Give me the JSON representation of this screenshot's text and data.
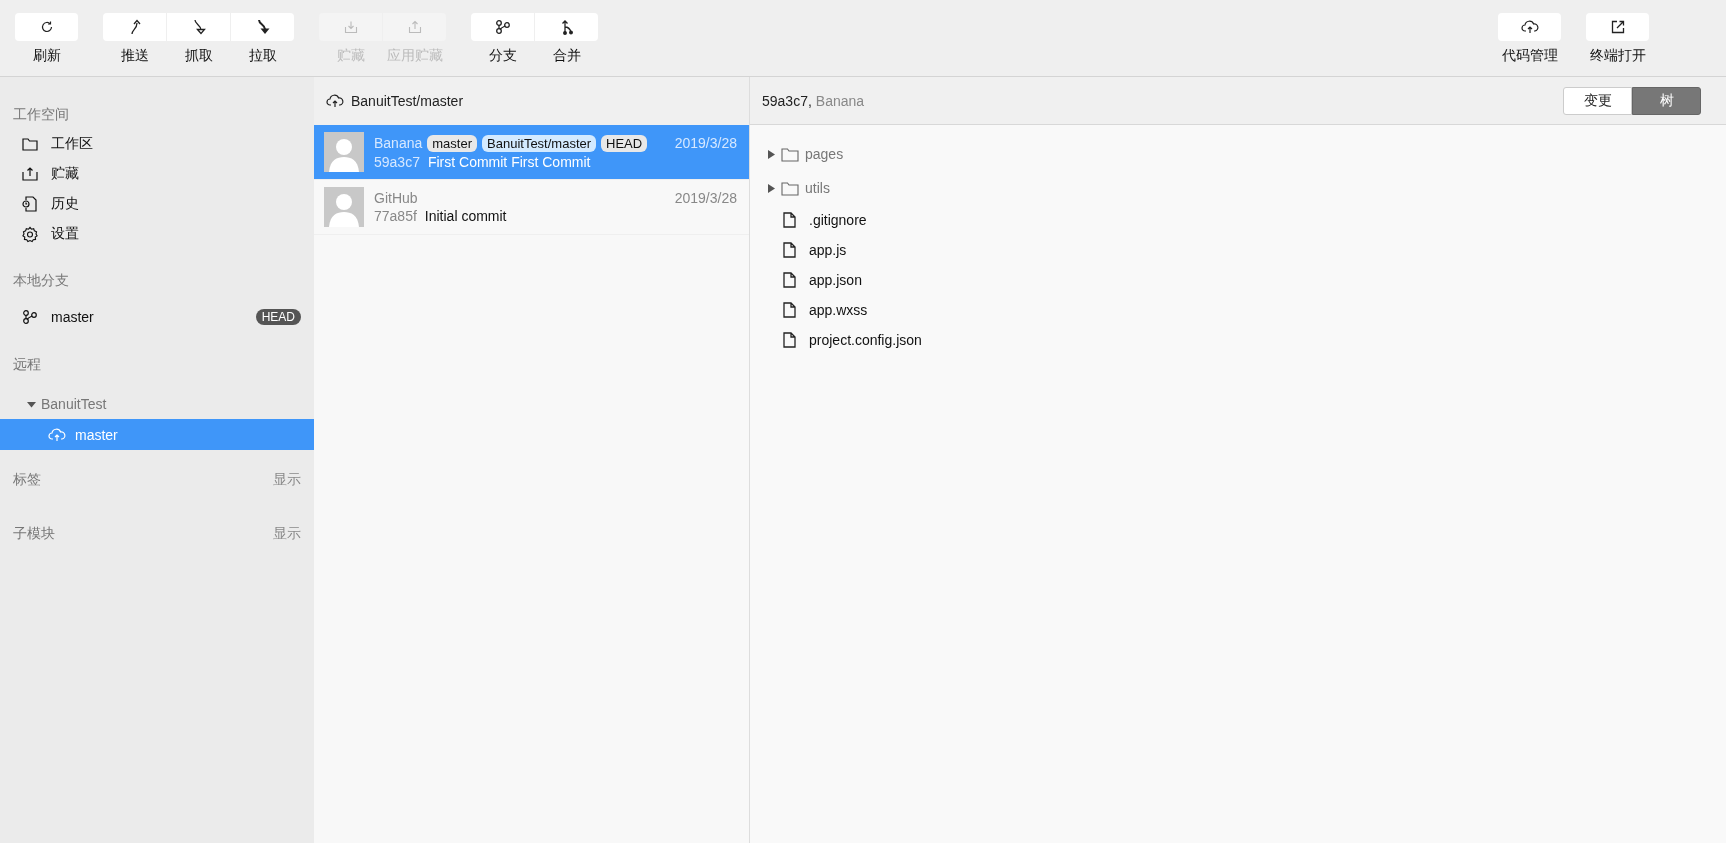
{
  "toolbar": {
    "left_groups": [
      {
        "buttons": [
          {
            "label": "刷新",
            "disabled": false
          }
        ]
      },
      {
        "buttons": [
          {
            "label": "推送",
            "disabled": false
          },
          {
            "label": "抓取",
            "disabled": false
          },
          {
            "label": "拉取",
            "disabled": false
          }
        ]
      },
      {
        "buttons": [
          {
            "label": "贮藏",
            "disabled": true
          },
          {
            "label": "应用贮藏",
            "disabled": true
          }
        ]
      },
      {
        "buttons": [
          {
            "label": "分支",
            "disabled": false
          },
          {
            "label": "合并",
            "disabled": false
          }
        ]
      }
    ],
    "right_buttons": [
      {
        "label": "代码管理",
        "disabled": false
      },
      {
        "label": "终端打开",
        "disabled": false
      }
    ]
  },
  "sidebar": {
    "workspace": {
      "title": "工作空间",
      "items": [
        {
          "label": "工作区",
          "selected": false
        },
        {
          "label": "贮藏",
          "selected": false
        },
        {
          "label": "历史",
          "selected": false
        },
        {
          "label": "设置",
          "selected": false
        }
      ]
    },
    "local_branches": {
      "title": "本地分支",
      "items": [
        {
          "label": "master",
          "badge": "HEAD",
          "selected": false
        }
      ]
    },
    "remotes": {
      "title": "远程",
      "items": [
        {
          "label": "BanuitTest",
          "expanded": true,
          "children": [
            {
              "label": "master",
              "selected": true
            }
          ]
        }
      ]
    },
    "tags": {
      "title": "标签",
      "action": "显示"
    },
    "submodules": {
      "title": "子模块",
      "action": "显示"
    }
  },
  "commit_list": {
    "header": "BanuitTest/master",
    "commits": [
      {
        "author": "Banana",
        "refs": [
          "master",
          "BanuitTest/master",
          "HEAD"
        ],
        "date": "2019/3/28",
        "hash": "59a3c7",
        "message": "First Commit First Commit",
        "selected": true
      },
      {
        "author": "GitHub",
        "date": "2019/3/28",
        "hash": "77a85f",
        "message": "Initial commit",
        "selected": false
      }
    ]
  },
  "detail": {
    "hash": "59a3c7,",
    "author": "Banana",
    "tabs": [
      {
        "label": "变更",
        "selected": false
      },
      {
        "label": "树",
        "selected": true
      }
    ],
    "tree": [
      {
        "kind": "folder",
        "name": "pages",
        "expanded": false
      },
      {
        "kind": "folder",
        "name": "utils",
        "expanded": false
      },
      {
        "kind": "file",
        "name": ".gitignore"
      },
      {
        "kind": "file",
        "name": "app.js"
      },
      {
        "kind": "file",
        "name": "app.json"
      },
      {
        "kind": "file",
        "name": "app.wxss"
      },
      {
        "kind": "file",
        "name": "project.config.json"
      }
    ]
  }
}
